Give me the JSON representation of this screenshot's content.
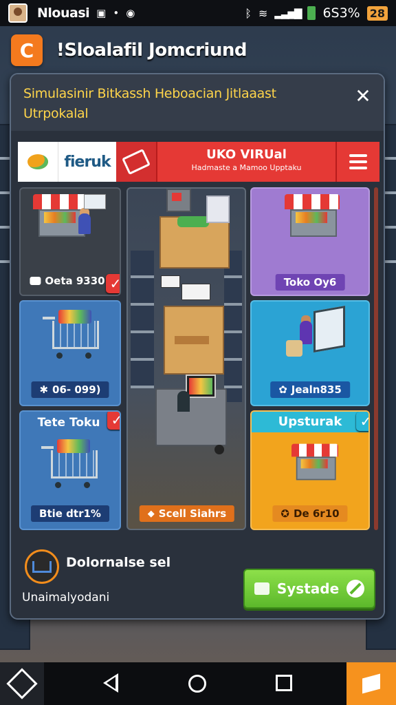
{
  "status_bar": {
    "carrier": "Nlouasi",
    "sim_icon": "sim-icon",
    "dot": "•",
    "battery": "6S3%",
    "badge": "28"
  },
  "app_header": {
    "logo_glyph": "C",
    "title": "!Sloalafil Jomcriund"
  },
  "panel": {
    "title": "Simulasinir Bitkassh Heboacian Jitlaaast Utrpokalal",
    "close_label": "✕"
  },
  "toolbar": {
    "brand": "fieruk",
    "store_title": "UKO VIRUal",
    "store_subtitle": "Hadmaste a Mamoo Upptaku"
  },
  "grid": {
    "card1_label": "Oeta 9330",
    "card3_label": "Toko Oy6",
    "card4_label": "06- 099)",
    "card5_label": "Jealn835",
    "card6_header": "Tete Toku",
    "card6_label": "Btie dtr1%",
    "card7_label": "Scell Siahrs",
    "card8_header": "Upsturak",
    "card8_label": "De 6r10"
  },
  "footer": {
    "title": "Dolornalse sel",
    "subtitle": "Unaimalyodani",
    "button_label": "Systade"
  },
  "colors": {
    "accent_orange": "#f47a1e",
    "store_red": "#e53935",
    "button_green": "#6cc936",
    "title_yellow": "#ffd54a"
  }
}
